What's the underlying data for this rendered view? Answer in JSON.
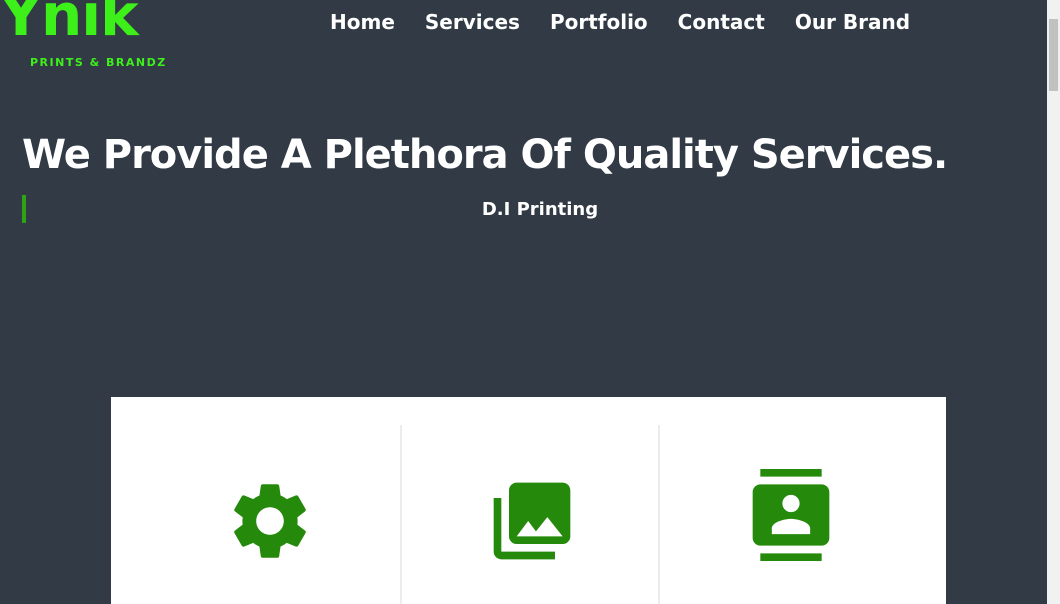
{
  "logo": {
    "wordmark": "Ynik",
    "tagline": "PRINTS & BRANDZ",
    "color": "#3df01a"
  },
  "nav": {
    "items": [
      {
        "label": "Home"
      },
      {
        "label": "Services"
      },
      {
        "label": "Portfolio"
      },
      {
        "label": "Contact"
      },
      {
        "label": "Our Brand"
      }
    ]
  },
  "hero": {
    "title": "We Provide A Plethora Of Quality Services.",
    "subtitle": "D.I Printing"
  },
  "services": {
    "icons": [
      "gear-icon",
      "photo-library-icon",
      "contact-card-icon"
    ],
    "icon_color": "#258a0c"
  },
  "colors": {
    "background": "#313a45",
    "accent": "#2ea313"
  }
}
